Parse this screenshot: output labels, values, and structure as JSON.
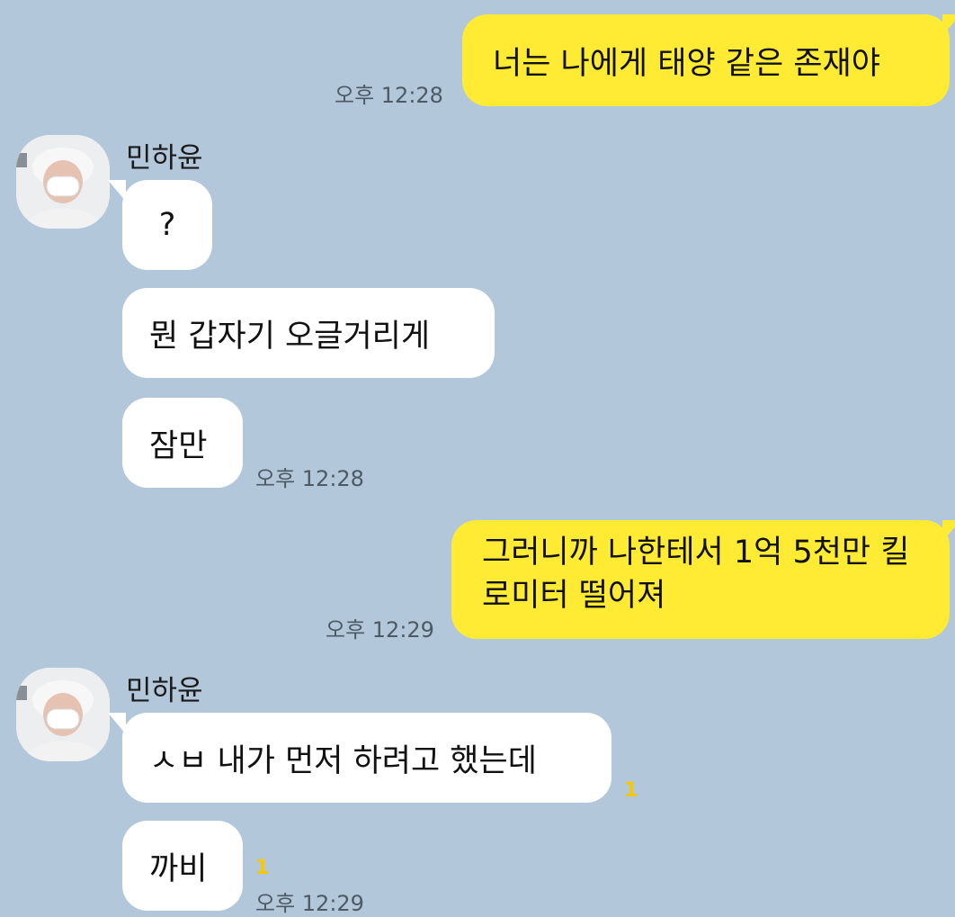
{
  "chat": {
    "messages": [
      {
        "from": "me",
        "text": "너는 나에게 태양 같은 존재야",
        "time": "오후 12:28"
      },
      {
        "from": "other",
        "name": "민하윤",
        "texts": [
          "?",
          "뭔 갑자기 오글거리게",
          "잠만"
        ],
        "time": "오후 12:28"
      },
      {
        "from": "me",
        "text": "그러니까 나한테서 1억 5천만 킬로미터 떨어져",
        "time": "오후 12:29"
      },
      {
        "from": "other",
        "name": "민하윤",
        "texts": [
          "ㅅㅂ 내가 먼저 하려고 했는데",
          "까비"
        ],
        "unread": [
          "1",
          "1"
        ],
        "time": "오후 12:29"
      }
    ]
  },
  "colors": {
    "background": "#b2c7d9",
    "sent_bubble": "#ffeb33",
    "received_bubble": "#ffffff",
    "unread": "#f5c800"
  }
}
